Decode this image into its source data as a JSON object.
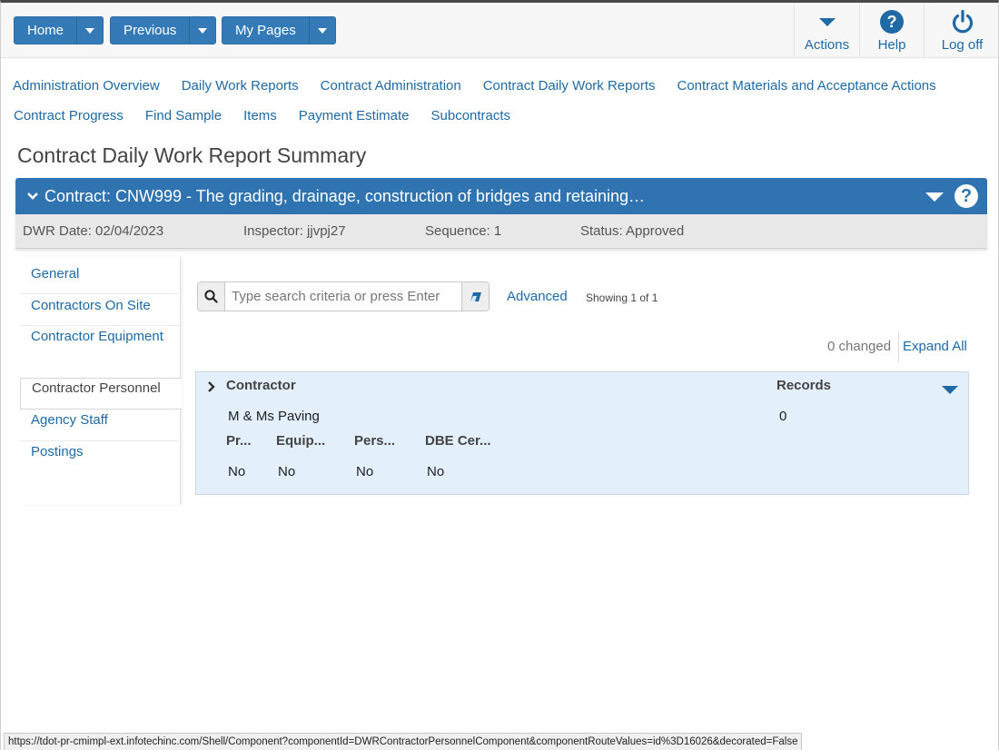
{
  "toolbar": {
    "home_label": "Home",
    "previous_label": "Previous",
    "mypages_label": "My Pages",
    "actions_label": "Actions",
    "help_label": "Help",
    "logoff_label": "Log off"
  },
  "nav": {
    "row1": [
      "Administration Overview",
      "Daily Work Reports",
      "Contract Administration",
      "Contract Daily Work Reports",
      "Contract Materials and Acceptance Actions"
    ],
    "row2": [
      "Contract Progress",
      "Find Sample",
      "Items",
      "Payment Estimate",
      "Subcontracts"
    ]
  },
  "page": {
    "title": "Contract Daily Work Report Summary"
  },
  "contract": {
    "title": "Contract: CNW999 - The grading, drainage, construction of bridges and retaining…"
  },
  "info": {
    "dwr_date": "DWR Date: 02/04/2023",
    "inspector": "Inspector: jjvpj27",
    "sequence": "Sequence: 1",
    "status": "Status: Approved"
  },
  "sidenav": {
    "items": [
      "General",
      "Contractors On Site",
      "Contractor Equipment",
      "Contractor Personnel",
      "Agency Staff",
      "Postings"
    ],
    "active": "Contractor Personnel"
  },
  "search": {
    "placeholder": "Type search criteria or press Enter",
    "value": "",
    "advanced_label": "Advanced",
    "showing": "Showing 1 of 1"
  },
  "grid_controls": {
    "changed": "0 changed",
    "expand_all": "Expand All"
  },
  "grid": {
    "columns": {
      "contractor": "Contractor",
      "records": "Records"
    },
    "row": {
      "contractor": "M & Ms Paving",
      "records": "0",
      "sub_headers": [
        "Pr...",
        "Equip...",
        "Pers...",
        "DBE Cer..."
      ],
      "sub_values": [
        "No",
        "No",
        "No",
        "No"
      ]
    }
  },
  "statusbar": {
    "url": "https://tdot-pr-cmimpl-ext.infotechinc.com/Shell/Component?componentId=DWRContractorPersonnelComponent&componentRouteValues=id%3D16026&decorated=False"
  },
  "colors": {
    "brand_blue": "#2f73b1",
    "link_blue": "#1f6aa5",
    "grid_bg": "#e3effa"
  },
  "icons": [
    "chevron-down-icon",
    "question-circle-icon",
    "power-icon",
    "search-icon",
    "eraser-icon",
    "chevron-right-icon"
  ]
}
